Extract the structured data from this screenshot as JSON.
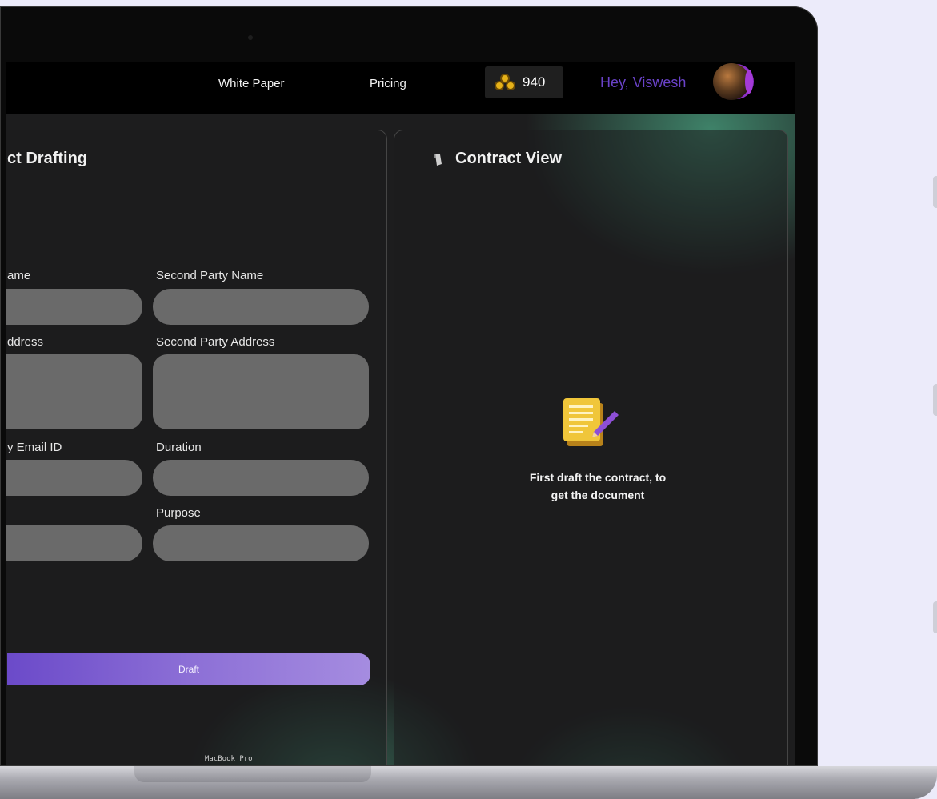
{
  "nav": {
    "links": [
      "White Paper",
      "Pricing"
    ],
    "coins": "940",
    "greeting": "Hey, Viswesh"
  },
  "drafting": {
    "title": "ct Drafting",
    "labels": {
      "first_name": "ame",
      "second_name": "Second Party Name",
      "first_address": "ddress",
      "second_address": "Second Party Address",
      "email": "y Email ID",
      "duration": "Duration",
      "purpose": "Purpose"
    },
    "draft_button": "Draft"
  },
  "contract_view": {
    "title": "Contract View",
    "empty_line1": "First draft the contract, to",
    "empty_line2": "get the document"
  },
  "dock_label": "MacBook Pro",
  "colors": {
    "accent": "#6a42c9",
    "button_start": "#6b4ac9",
    "button_end": "#a58ce0",
    "field": "#6a6a6a",
    "glow": "#4aa482"
  }
}
